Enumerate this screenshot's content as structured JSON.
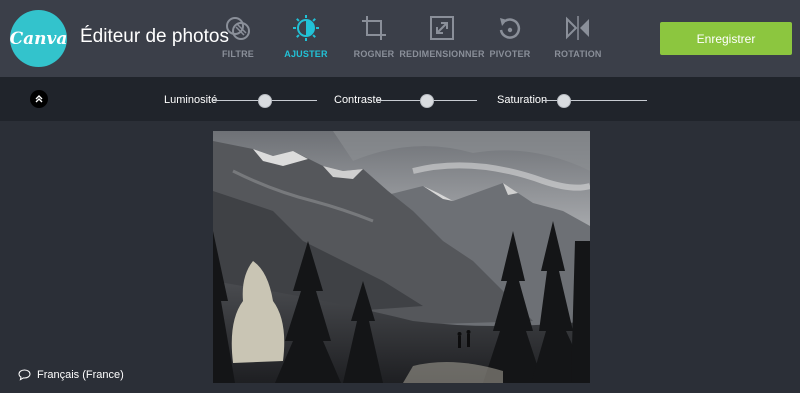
{
  "header": {
    "logo_text": "Canva",
    "app_title": "Éditeur de photos",
    "tools": [
      {
        "label": "FILTRE",
        "icon": "filter-icon",
        "active": false
      },
      {
        "label": "AJUSTER",
        "icon": "adjust-icon",
        "active": true
      },
      {
        "label": "ROGNER",
        "icon": "crop-icon",
        "active": false
      },
      {
        "label": "REDIMENSIONNER",
        "icon": "resize-icon",
        "active": false
      },
      {
        "label": "PIVOTER",
        "icon": "rotate-icon",
        "active": false
      },
      {
        "label": "ROTATION",
        "icon": "flip-icon",
        "active": false
      }
    ],
    "save_label": "Enregistrer"
  },
  "adjust": {
    "sliders": [
      {
        "label": "Luminosité",
        "value": 0.5
      },
      {
        "label": "Contraste",
        "value": 0.5
      },
      {
        "label": "Saturation",
        "value": 0.2
      }
    ]
  },
  "footer": {
    "language": "Français (France)"
  },
  "colors": {
    "accent": "#22c1d6",
    "save": "#8cc63f",
    "header_bg": "#3b3f49",
    "bar_bg": "#20242b",
    "canvas_bg": "#2b2f37"
  }
}
